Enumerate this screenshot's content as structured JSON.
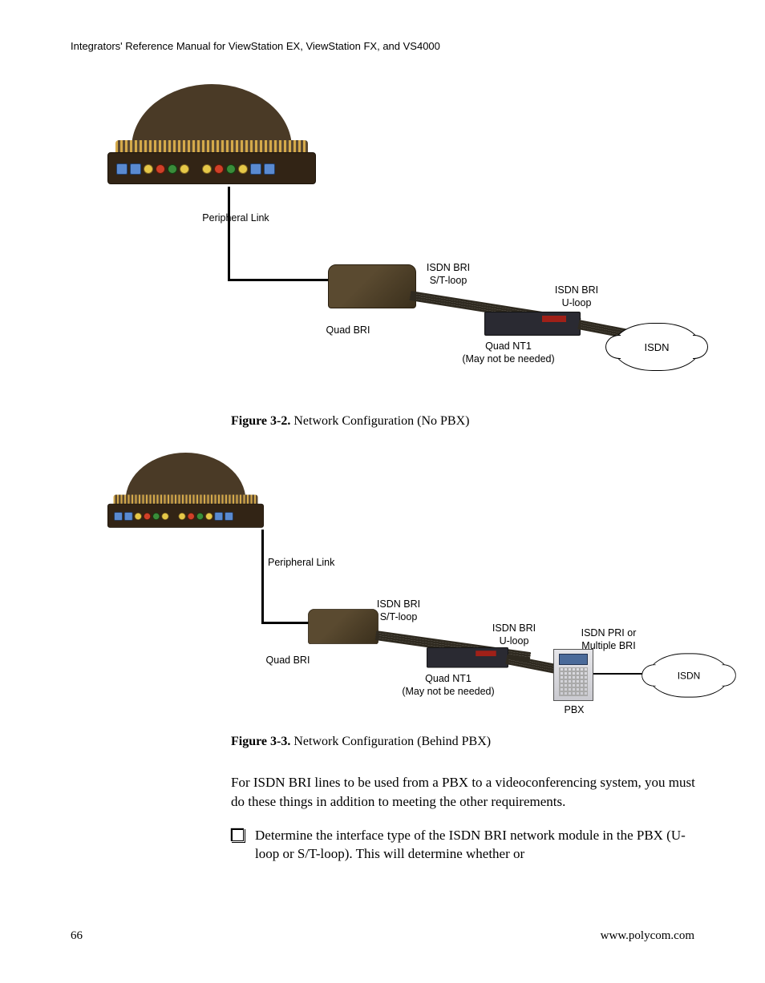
{
  "header": "Integrators' Reference Manual for ViewStation EX, ViewStation FX, and VS4000",
  "fig1": {
    "labels": {
      "peripheral_link": "Peripheral Link",
      "quad_bri": "Quad BRI",
      "isdn_bri_st": "ISDN BRI\nS/T-loop",
      "isdn_bri_u": "ISDN BRI\nU-loop",
      "quad_nt1": "Quad NT1\n(May not be needed)",
      "isdn": "ISDN"
    },
    "caption_bold": "Figure 3-2.",
    "caption_rest": "  Network Configuration (No PBX)"
  },
  "fig2": {
    "labels": {
      "peripheral_link": "Peripheral Link",
      "quad_bri": "Quad BRI",
      "isdn_bri_st": "ISDN BRI\nS/T-loop",
      "isdn_bri_u": "ISDN BRI\nU-loop",
      "quad_nt1": "Quad NT1\n(May not be needed)",
      "pbx": "PBX",
      "isdn_pri": "ISDN PRI or\nMultiple BRI",
      "isdn": "ISDN"
    },
    "caption_bold": "Figure 3-3.",
    "caption_rest": "  Network Configuration (Behind PBX)"
  },
  "body_para": "For ISDN BRI lines to be used from a PBX to a videoconferencing system, you must do these things in addition to meeting the other requirements.",
  "checklist_item_1": "Determine the interface type of the ISDN BRI network module in the PBX (U-loop or S/T-loop). This will determine whether or",
  "footer": {
    "page": "66",
    "url": "www.polycom.com"
  }
}
